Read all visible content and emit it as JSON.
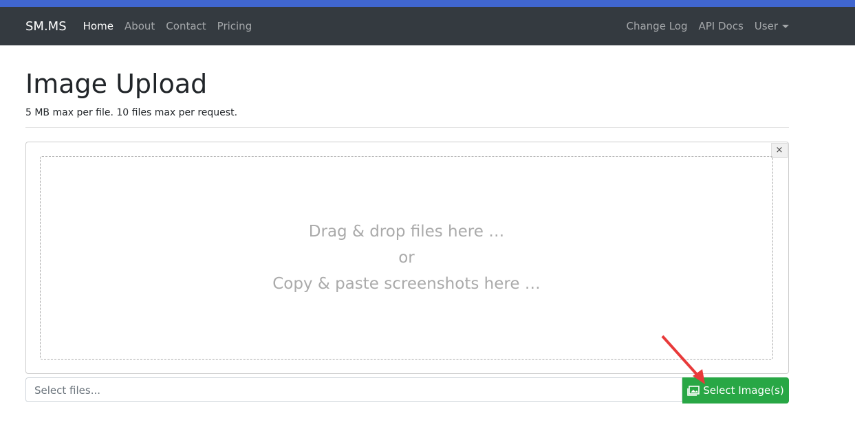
{
  "nav": {
    "brand": "SM.MS",
    "links": [
      "Home",
      "About",
      "Contact",
      "Pricing"
    ],
    "right": [
      "Change Log",
      "API Docs",
      "User"
    ]
  },
  "page": {
    "title": "Image Upload",
    "subtitle": "5 MB max per file. 10 files max per request."
  },
  "drop": {
    "line1": "Drag & drop files here …",
    "line2": "or",
    "line3": "Copy & paste screenshots here …",
    "close": "×"
  },
  "file": {
    "placeholder": "Select files...",
    "button": "Select Image(s)"
  }
}
